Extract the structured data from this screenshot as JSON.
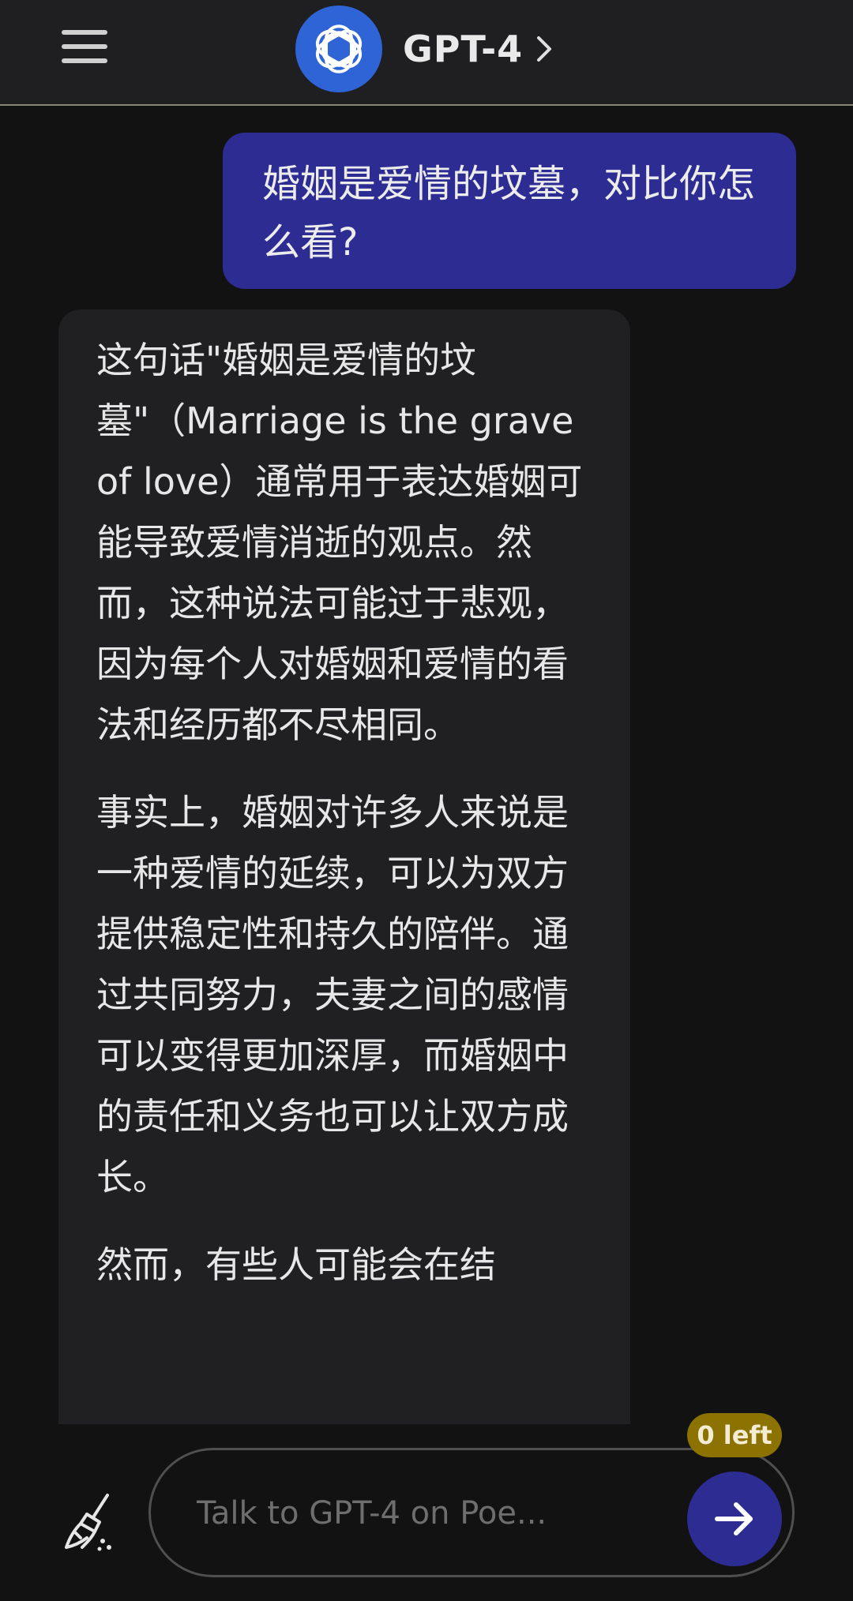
{
  "header": {
    "bot_name": "GPT-4",
    "icons": {
      "menu": "hamburger-menu-icon",
      "avatar": "openai-logo-icon",
      "chevron": "chevron-right-icon"
    }
  },
  "chat": {
    "user_message": "婚姻是爱情的坟墓，对比你怎么看?",
    "bot_paragraphs": [
      "这句话\"婚姻是爱情的坟墓\"（Marriage is the grave of love）通常用于表达婚姻可能导致爱情消逝的观点。然而，这种说法可能过于悲观，因为每个人对婚姻和爱情的看法和经历都不尽相同。",
      "事实上，婚姻对许多人来说是一种爱情的延续，可以为双方提供稳定性和持久的陪伴。通过共同努力，夫妻之间的感情可以变得更加深厚，而婚姻中的责任和义务也可以让双方成长。",
      "然而，有些人可能会在结"
    ]
  },
  "composer": {
    "placeholder": "Talk to GPT-4 on Poe...",
    "remaining_label": "0 left",
    "icons": {
      "clear": "broom-icon",
      "send": "arrow-right-icon"
    }
  },
  "colors": {
    "background": "#121212",
    "header": "#1f1f21",
    "user_bubble": "#2c2c93",
    "bot_bubble": "#202022",
    "avatar": "#2f64d6",
    "badge": "#8c7200"
  }
}
